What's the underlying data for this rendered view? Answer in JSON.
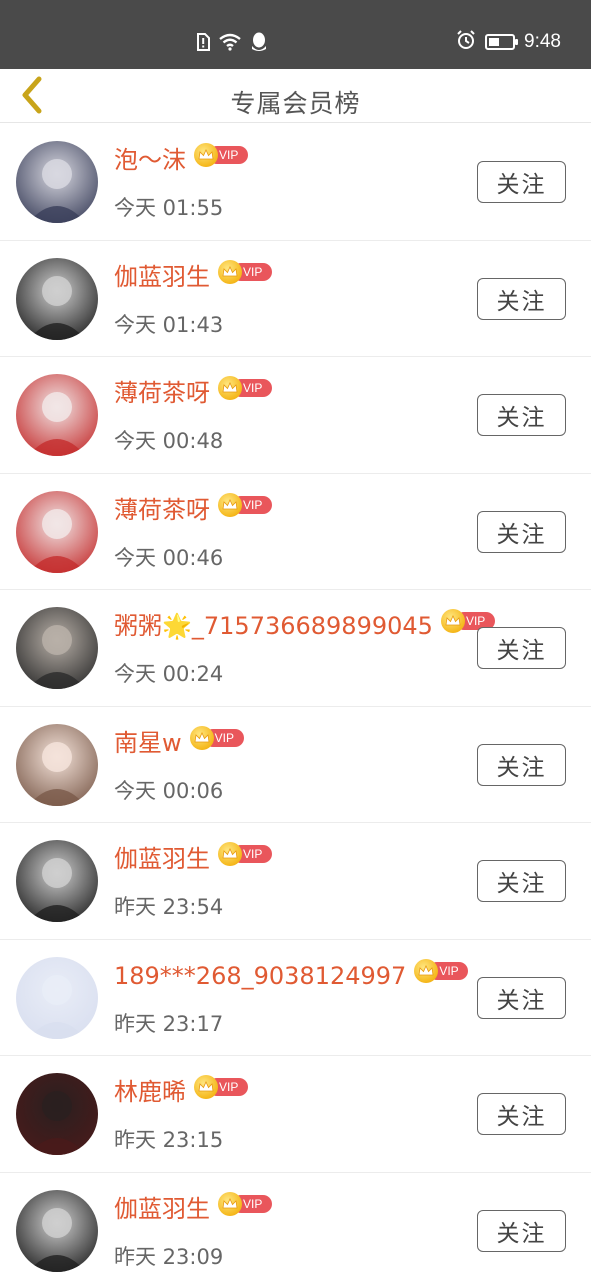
{
  "status_bar": {
    "time": "9:48",
    "icons": [
      "sim-alert-icon",
      "wifi-icon",
      "qq-icon",
      "alarm-icon",
      "battery-icon"
    ],
    "battery_level": 0.45
  },
  "header": {
    "back_icon": "chevron-left-icon",
    "title": "专属会员榜"
  },
  "colors": {
    "name": "#e05a33",
    "vip_tag": "#e9565b",
    "crown": "#f5b81c",
    "status_bar": "#4a4a4a",
    "back_icon": "#c8a41a"
  },
  "members": [
    {
      "name": "泡～沫",
      "vip": "VIP",
      "time": "今天 01:55",
      "follow": "关注",
      "avatar": [
        "#3a3f5a",
        "#d8d8e0"
      ]
    },
    {
      "name": "伽蓝羽生",
      "vip": "VIP",
      "time": "今天 01:43",
      "follow": "关注",
      "avatar": [
        "#1f1f1f",
        "#cfcfcf"
      ]
    },
    {
      "name": "薄荷茶呀",
      "vip": "VIP",
      "time": "今天 00:48",
      "follow": "关注",
      "avatar": [
        "#c42d2d",
        "#f1e6e6"
      ]
    },
    {
      "name": "薄荷茶呀",
      "vip": "VIP",
      "time": "今天 00:46",
      "follow": "关注",
      "avatar": [
        "#c42d2d",
        "#f1e6e6"
      ]
    },
    {
      "name": "粥粥🌟_715736689899045",
      "vip": "VIP",
      "time": "今天 00:24",
      "follow": "关注",
      "avatar": [
        "#2b2b2b",
        "#b8b0a8"
      ]
    },
    {
      "name": "南星w",
      "vip": "VIP",
      "time": "今天 00:06",
      "follow": "关注",
      "avatar": [
        "#7a5a4a",
        "#f4e3da"
      ]
    },
    {
      "name": "伽蓝羽生",
      "vip": "VIP",
      "time": "昨天 23:54",
      "follow": "关注",
      "avatar": [
        "#1f1f1f",
        "#cfcfcf"
      ]
    },
    {
      "name": "189***268_9038124997",
      "vip": "VIP",
      "time": "昨天 23:17",
      "follow": "关注",
      "avatar": [
        "#d8deef",
        "#e9edf7"
      ]
    },
    {
      "name": "林鹿晞",
      "vip": "VIP",
      "time": "昨天 23:15",
      "follow": "关注",
      "avatar": [
        "#4a1a1a",
        "#2a2020"
      ]
    },
    {
      "name": "伽蓝羽生",
      "vip": "VIP",
      "time": "昨天 23:09",
      "follow": "关注",
      "avatar": [
        "#1f1f1f",
        "#cfcfcf"
      ]
    }
  ]
}
